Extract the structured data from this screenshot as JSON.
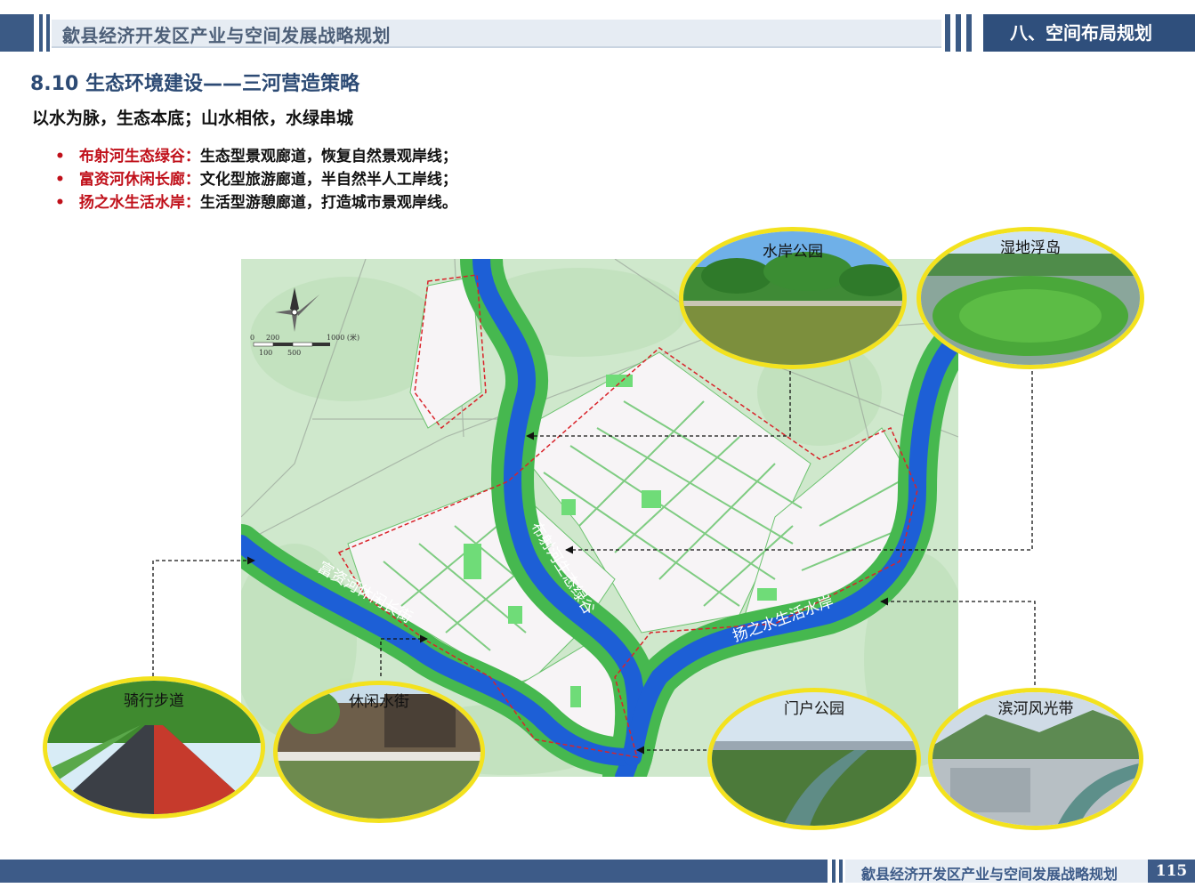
{
  "header": {
    "doc_title": "歙县经济开发区产业与空间发展战略规划",
    "section": "八、空间布局规划"
  },
  "slide": {
    "title": "8.10 生态环境建设——三河营造策略",
    "subtitle": "以水为脉，生态本底；山水相依，水绿串城",
    "bullets": [
      {
        "name": "布射河生态绿谷：",
        "text": "生态型景观廊道，恢复自然景观岸线；"
      },
      {
        "name": "富资河休闲长廊：",
        "text": "文化型旅游廊道，半自然半人工岸线；"
      },
      {
        "name": "扬之水生活水岸：",
        "text": "生活型游憩廊道，打造城市景观岸线。"
      }
    ]
  },
  "map": {
    "scale_ticks_top": [
      "0",
      "200",
      "1000 (米)"
    ],
    "scale_ticks_bottom": [
      "100",
      "500"
    ],
    "river_labels": [
      "布射河生态绿谷",
      "富资河休闲长街",
      "扬之水生活水岸"
    ],
    "colors": {
      "green_base": "#cfe8cc",
      "corridor": "#4fbf5a",
      "river": "#1d5fd6",
      "plan_area": "#f7f4f6",
      "boundary": "#d9232a"
    }
  },
  "photos": [
    {
      "label": "水岸公园"
    },
    {
      "label": "湿地浮岛"
    },
    {
      "label": "骑行步道"
    },
    {
      "label": "休闲水街"
    },
    {
      "label": "门户公园"
    },
    {
      "label": "滨河风光带"
    }
  ],
  "footer": {
    "doc_title": "歙县经济开发区产业与空间发展战略规划",
    "page": "115"
  }
}
